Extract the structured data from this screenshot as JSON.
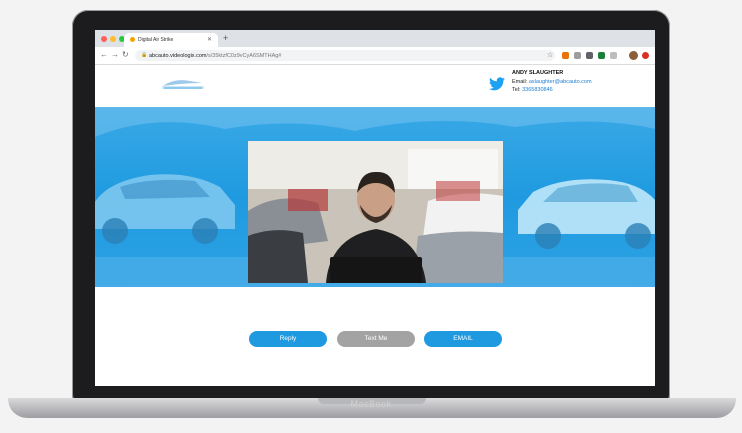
{
  "browser": {
    "tab_title": "Digital Air Strike",
    "url_domain": "abcauto.videologix.com",
    "url_path": "/s/35ktzfC0z9vCyA6SMTHAg#"
  },
  "contact": {
    "name": "ANDY SLAUGHTER",
    "email_label": "Email:",
    "email": "aslaughter@abcauto.com",
    "tel_label": "Tel:",
    "tel": "3365830846"
  },
  "actions": {
    "reply": "Reply",
    "text": "Text Me",
    "email": "EMAIL"
  },
  "device": {
    "brand": "MacBook"
  },
  "colors": {
    "accent": "#1f9ae0",
    "muted": "#a3a3a3"
  }
}
